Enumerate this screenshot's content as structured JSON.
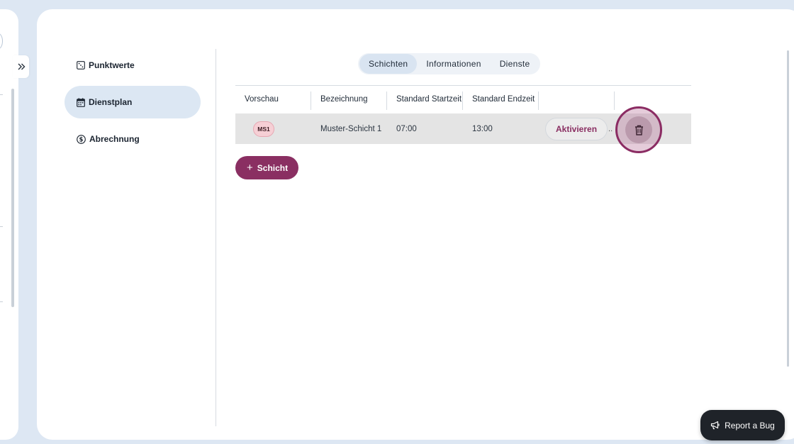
{
  "nav": {
    "items": [
      {
        "label": "Punktwerte",
        "icon": "dice-icon"
      },
      {
        "label": "Dienstplan",
        "icon": "calendar-icon",
        "active": true
      },
      {
        "label": "Abrechnung",
        "icon": "dollar-circle-icon"
      }
    ]
  },
  "tabs": [
    {
      "label": "Schichten",
      "active": true
    },
    {
      "label": "Informationen"
    },
    {
      "label": "Dienste"
    }
  ],
  "table": {
    "headers": [
      "Vorschau",
      "Bezeichnung",
      "Standard Startzeit",
      "Standard Endzeit",
      "",
      ""
    ],
    "rows": [
      {
        "badge": "MS1",
        "name": "Muster-Schicht 1",
        "start": "07:00",
        "end": "13:00",
        "action": "Aktivieren",
        "more": "..",
        "delete_icon": "trash-icon"
      }
    ]
  },
  "add_button": {
    "label": "Schicht",
    "icon": "plus-icon"
  },
  "report_button": {
    "label": "Report a Bug",
    "icon": "megaphone-icon"
  },
  "colors": {
    "accent": "#8a2f62",
    "active_bg": "#dce7f3",
    "page_bg": "#dde7f3"
  }
}
